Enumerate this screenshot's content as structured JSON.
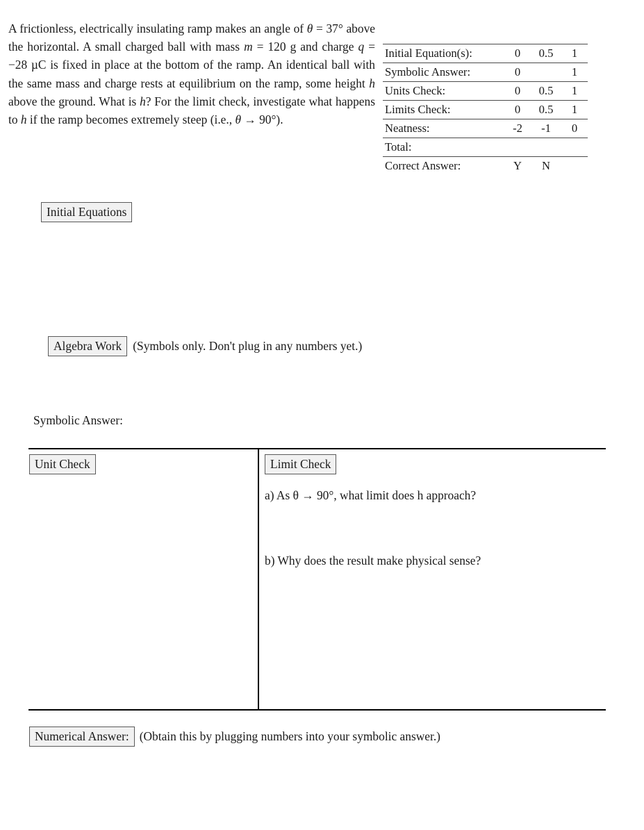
{
  "problem": {
    "text_runs": [
      {
        "t": "A frictionless, electrically insulating ramp makes an angle of ",
        "style": "roman"
      },
      {
        "t": "θ",
        "style": "math"
      },
      {
        "t": " = 37° above the horizontal. A small charged ball with mass ",
        "style": "roman"
      },
      {
        "t": "m",
        "style": "math"
      },
      {
        "t": " = 120 g and charge ",
        "style": "roman"
      },
      {
        "t": "q",
        "style": "math"
      },
      {
        "t": " = −28 µC is fixed in place at the bottom of the ramp. An identical ball with the same mass and charge rests at equilibrium on the ramp, some height ",
        "style": "roman"
      },
      {
        "t": "h",
        "style": "math"
      },
      {
        "t": " above the ground. What is ",
        "style": "roman"
      },
      {
        "t": "h",
        "style": "math"
      },
      {
        "t": "? For the limit check, investigate what happens to ",
        "style": "roman"
      },
      {
        "t": "h",
        "style": "math"
      },
      {
        "t": " if the ramp becomes extremely steep (i.e., ",
        "style": "roman"
      },
      {
        "t": "θ",
        "style": "math"
      },
      {
        "t": " → 90°).",
        "style": "roman"
      }
    ],
    "full_text": "A frictionless, electrically insulating ramp makes an angle of θ = 37° above the horizontal. A small charged ball with mass m = 120 g and charge q = −28 µC is fixed in place at the bottom of the ramp. An identical ball with the same mass and charge rests at equilibrium on the ramp, some height h above the ground. What is h? For the limit check, investigate what happens to h if the ramp becomes extremely steep (i.e., θ → 90°).",
    "angle_value": "37°",
    "mass_value": "120 g",
    "charge_value": "−28 µC",
    "limit_value": "90°"
  },
  "grading_table": {
    "clipped_top_row": " ",
    "rows": [
      {
        "label": "Initial Equation(s):",
        "scores": [
          "0",
          "0.5",
          "1"
        ]
      },
      {
        "label": "Symbolic Answer:",
        "scores": [
          "0",
          "",
          "1"
        ]
      },
      {
        "label": "Units Check:",
        "scores": [
          "0",
          "0.5",
          "1"
        ]
      },
      {
        "label": "Limits Check:",
        "scores": [
          "0",
          "0.5",
          "1"
        ]
      },
      {
        "label": "Neatness:",
        "scores": [
          "-2",
          "-1",
          "0"
        ]
      },
      {
        "label": "Total:",
        "scores": [
          "",
          "",
          ""
        ]
      },
      {
        "label": "Correct Answer:",
        "scores": [
          "Y",
          "N",
          ""
        ]
      }
    ]
  },
  "sections": {
    "initial_equations_label": "Initial Equations",
    "algebra_work_label": "Algebra Work",
    "algebra_work_note": "(Symbols only. Don't plug in any numbers yet.)",
    "symbolic_answer_label": "Symbolic Answer:",
    "unit_check_label": "Unit Check",
    "limit_check_label": "Limit Check",
    "limit_question_a": "a) As θ → 90°, what limit does h approach?",
    "limit_question_b": "b) Why does the result make physical sense?",
    "numerical_answer_label": "Numerical Answer:",
    "numerical_answer_note": "(Obtain this by plugging numbers into your symbolic answer.)"
  },
  "colors": {
    "page_background": "#ffffff",
    "text": "#1a1a1a",
    "box_fill": "#f1f1f1",
    "box_border": "#5a5a5a",
    "table_rule": "#4a4a4a",
    "heavy_rule": "#000000"
  }
}
